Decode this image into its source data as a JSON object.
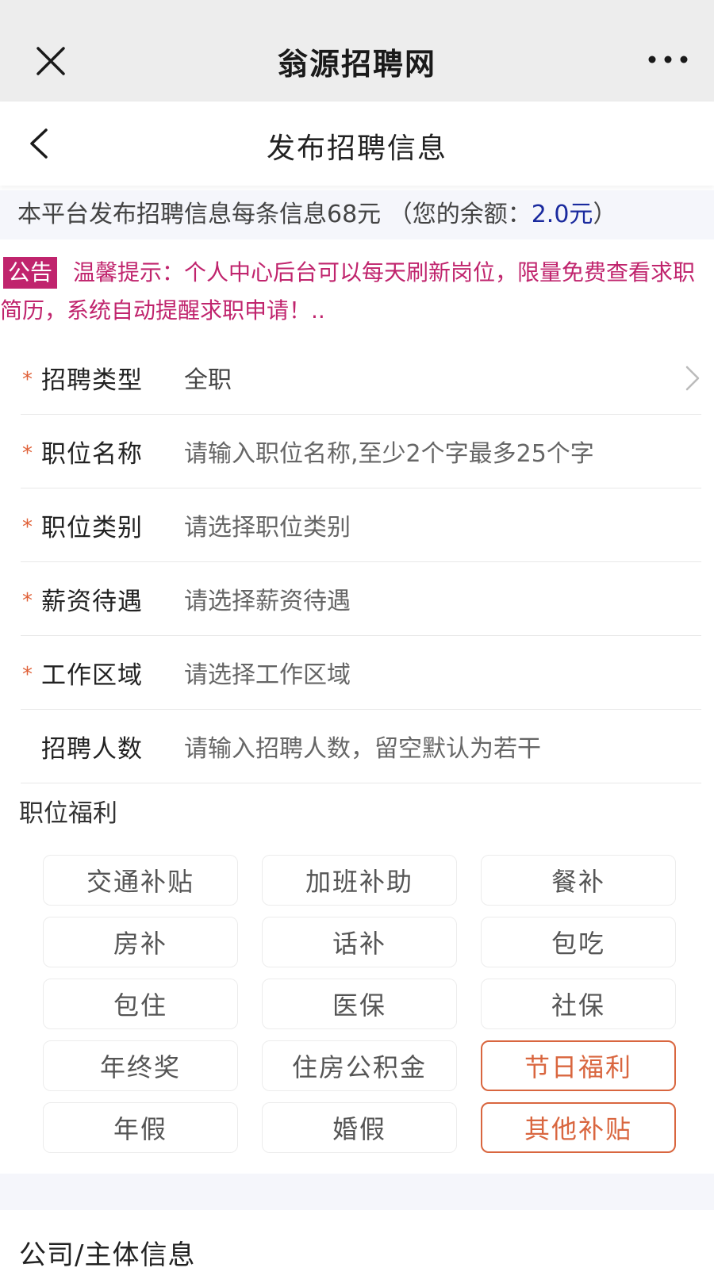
{
  "topbar": {
    "title": "翁源招聘网"
  },
  "navbar": {
    "page_title": "发布招聘信息"
  },
  "price_bar": {
    "text": "本平台发布招聘信息每条信息68元 （您的余额：",
    "balance": "2.0元",
    "suffix": "）"
  },
  "notice": {
    "badge": "公告",
    "text": "温馨提示：个人中心后台可以每天刷新岗位，限量免费查看求职简历，系统自动提醒求职申请！.."
  },
  "form": {
    "rows": [
      {
        "required": "*",
        "label": "招聘类型",
        "value": "全职"
      },
      {
        "required": "*",
        "label": "职位名称",
        "placeholder": "请输入职位名称,至少2个字最多25个字"
      },
      {
        "required": "*",
        "label": "职位类别",
        "placeholder": "请选择职位类别"
      },
      {
        "required": "*",
        "label": "薪资待遇",
        "placeholder": "请选择薪资待遇"
      },
      {
        "required": "*",
        "label": "工作区域",
        "placeholder": "请选择工作区域"
      },
      {
        "required": "",
        "label": "招聘人数",
        "placeholder": "请输入招聘人数，留空默认为若干"
      }
    ]
  },
  "benefits": {
    "title": "职位福利",
    "items": [
      {
        "label": "交通补贴",
        "selected": false
      },
      {
        "label": "加班补助",
        "selected": false
      },
      {
        "label": "餐补",
        "selected": false
      },
      {
        "label": "房补",
        "selected": false
      },
      {
        "label": "话补",
        "selected": false
      },
      {
        "label": "包吃",
        "selected": false
      },
      {
        "label": "包住",
        "selected": false
      },
      {
        "label": "医保",
        "selected": false
      },
      {
        "label": "社保",
        "selected": false
      },
      {
        "label": "年终奖",
        "selected": false
      },
      {
        "label": "住房公积金",
        "selected": false
      },
      {
        "label": "节日福利",
        "selected": true
      },
      {
        "label": "年假",
        "selected": false
      },
      {
        "label": "婚假",
        "selected": false
      },
      {
        "label": "其他补贴",
        "selected": true
      }
    ]
  },
  "company": {
    "title": "公司/主体信息"
  },
  "colors": {
    "accent": "#d9663f",
    "notice": "#c0246d",
    "balance": "#1a2a9e",
    "required_star": "#e0623a"
  }
}
